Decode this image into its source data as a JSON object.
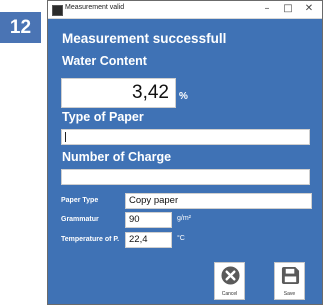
{
  "step_number": "12",
  "window": {
    "title": "Measurement valid",
    "controls": {
      "minimize": "–",
      "maximize": "□",
      "close": "✕"
    }
  },
  "heading": "Measurement successfull",
  "water_content": {
    "label": "Water Content",
    "value": "3,42",
    "unit": "%"
  },
  "type_of_paper": {
    "label": "Type of Paper",
    "value": ""
  },
  "number_of_charge": {
    "label": "Number of Charge",
    "value": ""
  },
  "details": {
    "paper_type": {
      "label": "Paper Type",
      "value": "Copy paper"
    },
    "grammatur": {
      "label": "Grammatur",
      "value": "90",
      "unit": "g/m²"
    },
    "temperature": {
      "label": "Temperature of P.",
      "value": "22,4",
      "unit": "°C"
    }
  },
  "buttons": {
    "cancel": {
      "label": "Cancel",
      "icon": "cancel-icon"
    },
    "save": {
      "label": "Save",
      "icon": "save-icon"
    }
  },
  "colors": {
    "window_bg": "#3f72b5",
    "badge_bg": "#4a74b4",
    "icon_gray": "#5a5a5a"
  }
}
